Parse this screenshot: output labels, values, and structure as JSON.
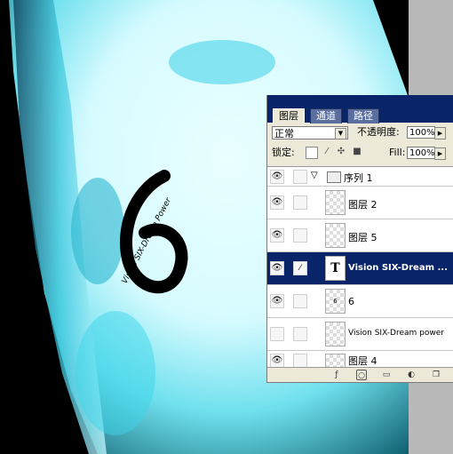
{
  "canvas": {
    "logo_text": "Vision SIX-Dream Power",
    "logo_numeral": "6"
  },
  "panel": {
    "tabs": [
      "图层",
      "通道",
      "路径"
    ],
    "blend_mode": "正常",
    "opacity_label": "不透明度:",
    "opacity_value": "100%",
    "lock_label": "锁定:",
    "fill_label": "Fill:",
    "fill_value": "100%",
    "group": {
      "name": "序列 1",
      "expander": "▽"
    },
    "layers": [
      {
        "name": "图层 2",
        "thumb": ""
      },
      {
        "name": "图层 5",
        "thumb": ""
      },
      {
        "name": "Vision SIX-Dream ...",
        "thumb": "T",
        "selected": true
      },
      {
        "name": "6",
        "thumb": "6"
      },
      {
        "name": "Vision SIX-Dream power",
        "thumb": ""
      },
      {
        "name": "图层 4",
        "thumb": ""
      }
    ],
    "colors": {
      "title": "#0a246a",
      "panel_bg": "#ece9d8",
      "selected": "#0a246a"
    }
  }
}
